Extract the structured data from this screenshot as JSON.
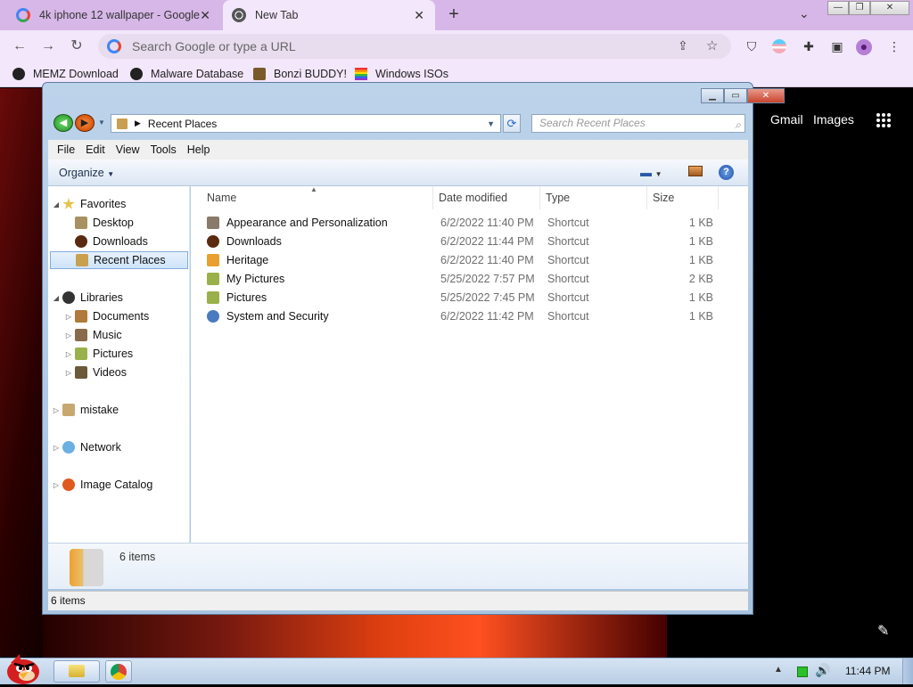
{
  "browser": {
    "tabs": [
      {
        "title": "4k iphone 12 wallpaper - Google",
        "active": false
      },
      {
        "title": "New Tab",
        "active": true
      }
    ],
    "new_tab_symbol": "+",
    "omnibox_placeholder": "Search Google or type a URL",
    "bookmarks": [
      {
        "label": "MEMZ Download",
        "icon": "globe-icon"
      },
      {
        "label": "Malware Database",
        "icon": "globe-icon"
      },
      {
        "label": "Bonzi BUDDY!",
        "icon": "bonzi-icon"
      },
      {
        "label": "Windows ISOs",
        "icon": "windows-flag-icon"
      }
    ],
    "ntp_links": {
      "gmail": "Gmail",
      "images": "Images"
    }
  },
  "explorer": {
    "address": "Recent Places",
    "search_placeholder": "Search Recent Places",
    "menu": [
      "File",
      "Edit",
      "View",
      "Tools",
      "Help"
    ],
    "organize": "Organize",
    "nav": {
      "favorites": "Favorites",
      "favorites_items": [
        "Desktop",
        "Downloads",
        "Recent Places"
      ],
      "libraries": "Libraries",
      "library_items": [
        "Documents",
        "Music",
        "Pictures",
        "Videos"
      ],
      "mistake": "mistake",
      "network": "Network",
      "image_catalog": "Image Catalog"
    },
    "columns": {
      "name": "Name",
      "date": "Date modified",
      "type": "Type",
      "size": "Size"
    },
    "files": [
      {
        "name": "Appearance and Personalization",
        "date": "6/2/2022 11:40 PM",
        "type": "Shortcut",
        "size": "1 KB"
      },
      {
        "name": "Downloads",
        "date": "6/2/2022 11:44 PM",
        "type": "Shortcut",
        "size": "1 KB"
      },
      {
        "name": "Heritage",
        "date": "6/2/2022 11:40 PM",
        "type": "Shortcut",
        "size": "1 KB"
      },
      {
        "name": "My Pictures",
        "date": "5/25/2022 7:57 PM",
        "type": "Shortcut",
        "size": "2 KB"
      },
      {
        "name": "Pictures",
        "date": "5/25/2022 7:45 PM",
        "type": "Shortcut",
        "size": "1 KB"
      },
      {
        "name": "System and Security",
        "date": "6/2/2022 11:42 PM",
        "type": "Shortcut",
        "size": "1 KB"
      }
    ],
    "details_count": "6 items",
    "status": "6 items"
  },
  "taskbar": {
    "clock": "11:44 PM"
  },
  "colors": {
    "chrome_tab_bar": "#d7b7e8",
    "chrome_toolbar": "#f3e7fb",
    "explorer_frame": "#bcd3ea",
    "selection": "#cfe4fa"
  }
}
